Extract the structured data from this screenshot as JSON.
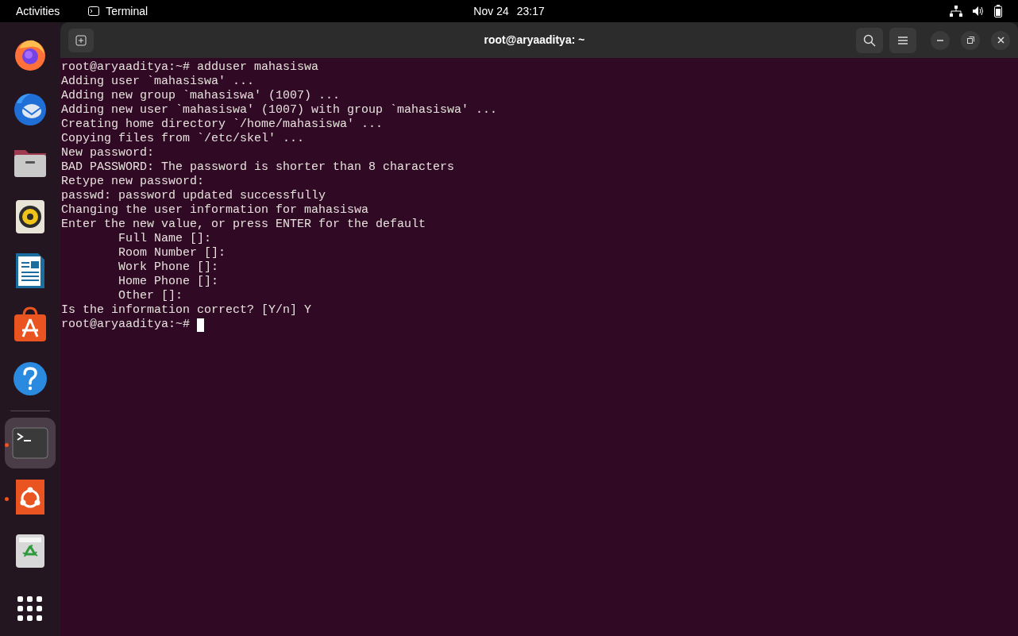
{
  "top_bar": {
    "activities": "Activities",
    "app_name": "Terminal",
    "date": "Nov 24",
    "time": "23:17"
  },
  "dock": {
    "items": [
      {
        "kind": "firefox",
        "running": false,
        "selected": false
      },
      {
        "kind": "thunderbird",
        "running": false,
        "selected": false
      },
      {
        "kind": "files",
        "running": false,
        "selected": false
      },
      {
        "kind": "rhythmbox",
        "running": false,
        "selected": false
      },
      {
        "kind": "writer",
        "running": false,
        "selected": false
      },
      {
        "kind": "appcenter",
        "running": false,
        "selected": false
      },
      {
        "kind": "help",
        "running": false,
        "selected": false
      },
      {
        "kind": "separator"
      },
      {
        "kind": "terminal",
        "running": true,
        "selected": true
      },
      {
        "kind": "ubuntu",
        "running": true,
        "selected": false
      },
      {
        "kind": "trash",
        "running": false,
        "selected": false
      }
    ]
  },
  "window": {
    "title": "root@aryaaditya: ~"
  },
  "terminal": {
    "lines": [
      "root@aryaaditya:~# adduser mahasiswa",
      "Adding user `mahasiswa' ...",
      "Adding new group `mahasiswa' (1007) ...",
      "Adding new user `mahasiswa' (1007) with group `mahasiswa' ...",
      "Creating home directory `/home/mahasiswa' ...",
      "Copying files from `/etc/skel' ...",
      "New password:",
      "BAD PASSWORD: The password is shorter than 8 characters",
      "Retype new password:",
      "passwd: password updated successfully",
      "Changing the user information for mahasiswa",
      "Enter the new value, or press ENTER for the default",
      "        Full Name []:",
      "        Room Number []:",
      "        Work Phone []:",
      "        Home Phone []:",
      "        Other []:",
      "Is the information correct? [Y/n] Y"
    ],
    "prompt": {
      "text": "root@aryaaditya:~# ",
      "cursor": true
    }
  }
}
